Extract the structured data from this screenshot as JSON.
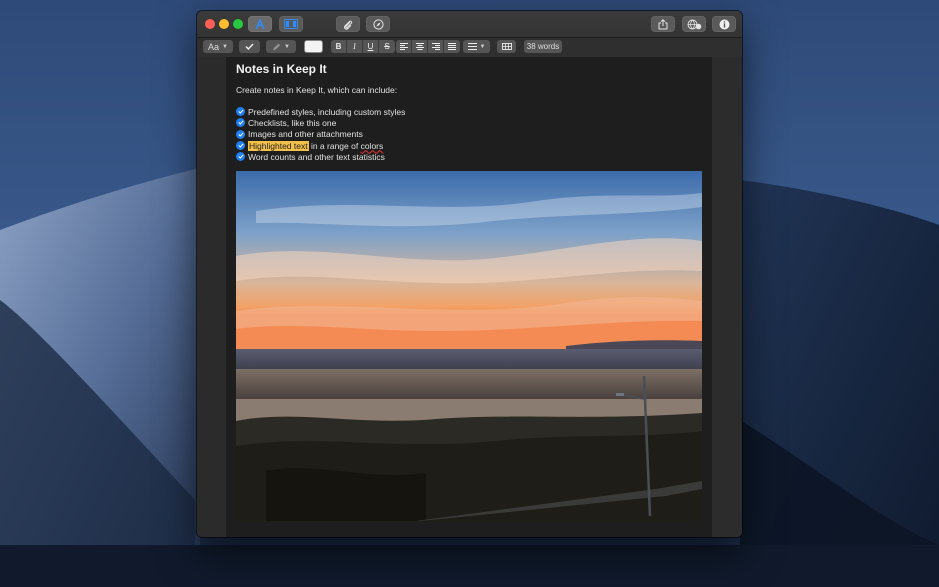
{
  "toolbar": {
    "styles_label": "Aa",
    "word_count": "38 words"
  },
  "note": {
    "title": "Notes in Keep It",
    "intro": "Create notes in Keep It, which can include:",
    "checklist": {
      "item0": "Predefined styles, including custom styles",
      "item1": "Checklists, like this one",
      "item2": "Images and other attachments",
      "item3_highlight": "Highlighted text",
      "item3_mid": " in a range of ",
      "item3_end": "colors",
      "item4": "Word counts and other text statistics"
    }
  },
  "colors": {
    "accent": "#1d7ff2",
    "highlight": "#f3c049",
    "close": "#fe5f57",
    "minimize": "#febc2e",
    "zoom": "#28c840"
  },
  "icons": [
    "format-a-icon",
    "sidebar-icon",
    "paperclip-icon",
    "compass-icon",
    "share-icon",
    "link-icon",
    "info-icon",
    "checkmark-icon",
    "pen-icon",
    "list-icon",
    "table-icon"
  ]
}
